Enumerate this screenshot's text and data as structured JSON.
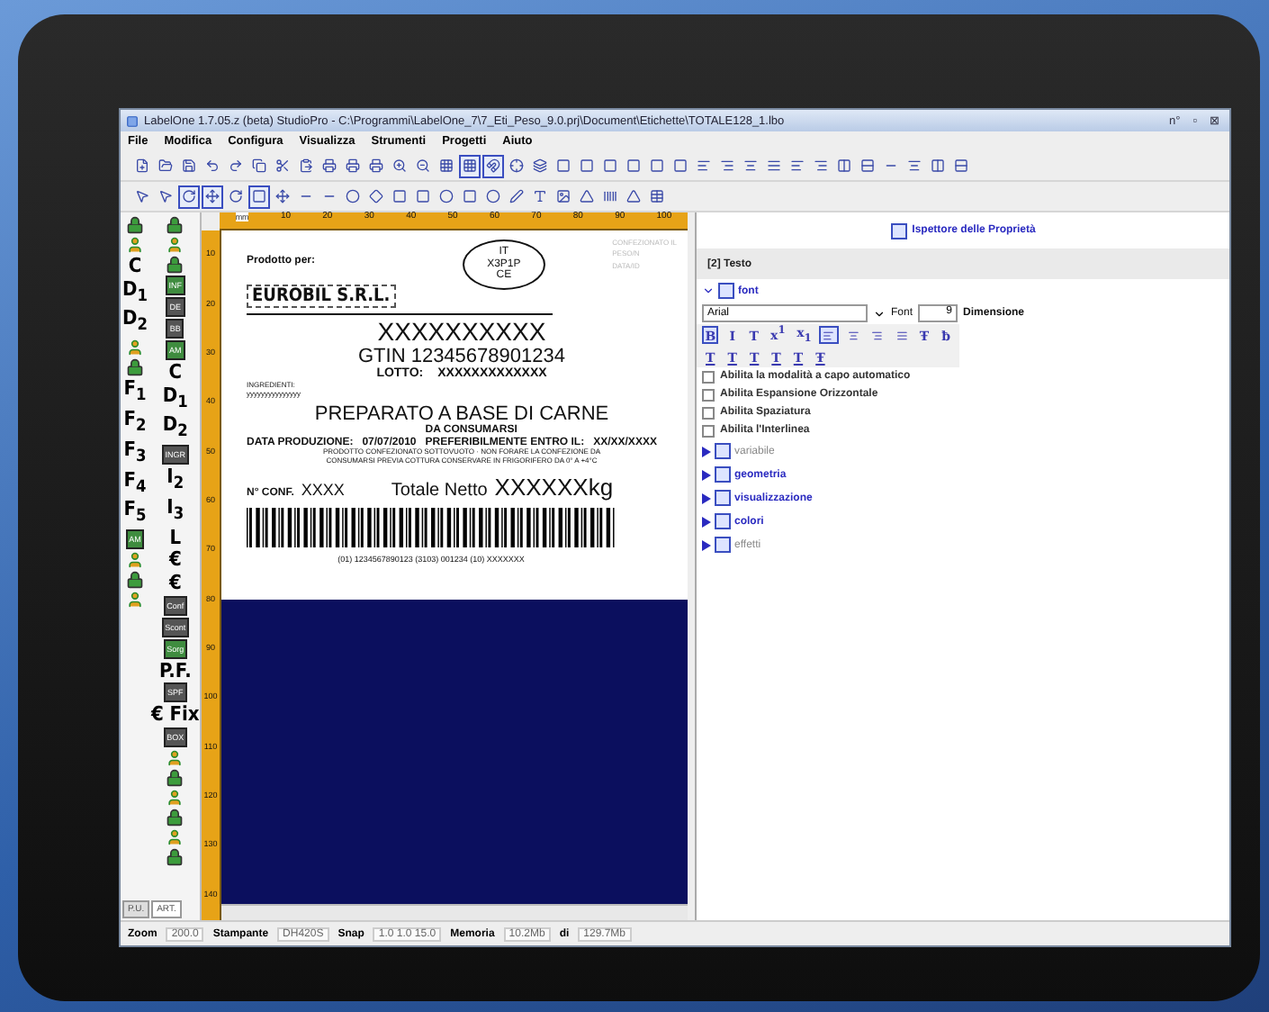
{
  "window": {
    "title": "LabelOne 1.7.05.z (beta) StudioPro - C:\\Programmi\\LabelOne_7\\7_Eti_Peso_9.0.prj\\Document\\Etichette\\TOTALE128_1.lbo",
    "controls": [
      "n°",
      "▫",
      "⊠"
    ]
  },
  "menu": [
    "File",
    "Modifica",
    "Configura",
    "Visualizza",
    "Strumenti",
    "Progetti",
    "Aiuto"
  ],
  "toolbar_1": [
    {
      "on": false
    },
    {
      "on": false
    },
    {
      "on": false
    },
    {
      "on": false
    },
    {
      "on": false
    },
    {
      "on": false
    },
    {
      "on": false
    },
    {
      "on": false
    },
    {
      "on": false
    },
    {
      "on": false
    },
    {
      "on": false
    },
    {
      "on": false
    },
    {
      "on": false
    },
    {
      "on": false
    },
    {
      "on": true
    },
    {
      "on": true
    },
    {
      "on": false
    },
    {
      "on": false
    },
    {
      "on": false
    },
    {
      "on": false
    },
    {
      "on": false
    },
    {
      "on": false
    },
    {
      "on": false
    },
    {
      "on": false
    },
    {
      "on": false
    },
    {
      "on": false
    },
    {
      "on": false
    },
    {
      "on": false
    },
    {
      "on": false
    },
    {
      "on": false
    },
    {
      "on": false
    },
    {
      "on": false
    },
    {
      "on": false
    },
    {
      "on": false
    },
    {
      "on": false
    },
    {
      "on": false
    }
  ],
  "toolbar_2": [
    {
      "on": false
    },
    {
      "on": false
    },
    {
      "on": true
    },
    {
      "on": true
    },
    {
      "on": false
    },
    {
      "on": true
    },
    {
      "on": false
    },
    {
      "on": false
    },
    {
      "on": false
    },
    {
      "on": false
    },
    {
      "on": false
    },
    {
      "on": false
    },
    {
      "on": false
    },
    {
      "on": false
    },
    {
      "on": false
    },
    {
      "on": false
    },
    {
      "on": false
    },
    {
      "on": false
    },
    {
      "on": false
    },
    {
      "on": false
    },
    {
      "on": false
    },
    {
      "on": false
    },
    {
      "on": false
    }
  ],
  "palette": {
    "column_1": [
      {
        "kind": "icon"
      },
      {
        "kind": "icon"
      },
      {
        "kind": "text",
        "label": "C"
      },
      {
        "kind": "text",
        "label": "D$_{1}$"
      },
      {
        "kind": "text",
        "label": "D$_{2}$"
      },
      {
        "kind": "icon"
      },
      {
        "kind": "icon"
      },
      {
        "kind": "text",
        "label": "F$_{1}$"
      },
      {
        "kind": "text",
        "label": "F$_{2}$"
      },
      {
        "kind": "text",
        "label": "F$_{3}$"
      },
      {
        "kind": "text",
        "label": "F$_{4}$"
      },
      {
        "kind": "text",
        "label": "F$_{5}$"
      },
      {
        "kind": "tile",
        "label": "AM"
      },
      {
        "kind": "icon"
      },
      {
        "kind": "icon"
      },
      {
        "kind": "icon"
      }
    ],
    "column_2": [
      {
        "kind": "icon"
      },
      {
        "kind": "icon"
      },
      {
        "kind": "icon"
      },
      {
        "kind": "tile",
        "label": "INF"
      },
      {
        "kind": "tile",
        "label": "DE"
      },
      {
        "kind": "tile",
        "label": "BB"
      },
      {
        "kind": "tile",
        "label": "AM"
      },
      {
        "kind": "text",
        "label": "C"
      },
      {
        "kind": "text",
        "label": "D$_{1}$"
      },
      {
        "kind": "text",
        "label": "D$_{2}$"
      },
      {
        "kind": "tile",
        "label": "INGR"
      },
      {
        "kind": "text",
        "label": "I$_{2}$"
      },
      {
        "kind": "text",
        "label": "I$_{3}$"
      },
      {
        "kind": "text",
        "label": "L"
      },
      {
        "kind": "text",
        "label": "€"
      },
      {
        "kind": "text",
        "label": "€"
      },
      {
        "kind": "tile",
        "label": "Conf"
      },
      {
        "kind": "tile",
        "label": "Scont"
      },
      {
        "kind": "tile",
        "label": "Sorg"
      },
      {
        "kind": "text",
        "label": "P.F."
      },
      {
        "kind": "tile",
        "label": "SPF"
      },
      {
        "kind": "text",
        "label": "€ Fix"
      },
      {
        "kind": "tile",
        "label": "BOX"
      },
      {
        "kind": "icon"
      },
      {
        "kind": "icon"
      },
      {
        "kind": "icon"
      },
      {
        "kind": "icon"
      },
      {
        "kind": "icon"
      },
      {
        "kind": "icon"
      }
    ],
    "tabs": [
      {
        "label": "P.U.",
        "selected": false
      },
      {
        "label": "ART.",
        "selected": true
      }
    ]
  },
  "rulers": {
    "unit": "mm",
    "horizontal": [
      "10",
      "20",
      "30",
      "40",
      "50",
      "60",
      "70",
      "80",
      "90",
      "100"
    ],
    "vertical": [
      "10",
      "20",
      "30",
      "40",
      "50",
      "60",
      "70",
      "80",
      "90",
      "100",
      "110",
      "120",
      "130",
      "140"
    ]
  },
  "label": {
    "producer_caption": "Prodotto per:",
    "producer": "EUROBIL S.R.L.",
    "stamp": [
      "IT",
      "X3P1P",
      "CE"
    ],
    "faint_fields": [
      "CONFEZIONATO IL",
      "PESO/N",
      "DATA/ID"
    ],
    "product_code": "XXXXXXXXXX",
    "gtin": "GTIN  12345678901234",
    "lot_caption": "LOTTO:",
    "lot": "XXXXXXXXXXXXX",
    "ingredients_caption": "INGREDIENTI:",
    "ingredients": "yyyyyyyyyyyyyyy",
    "product_name": "PREPARATO A BASE DI CARNE",
    "production_caption": "DATA PRODUZIONE:",
    "production_date": "07/07/2010",
    "expiry_caption_1": "DA CONSUMARSI",
    "expiry_caption_2": "PREFERIBILMENTE ENTRO IL:",
    "expiry": "XX/XX/XXXX",
    "notes": "PRODOTTO CONFEZIONATO SOTTOVUOTO · NON FORARE LA CONFEZIONE DA CONSUMARSI PREVIA COTTURA CONSERVARE IN FRIGORIFERO DA 0° A +4°C",
    "pieces_caption": "N° CONF.",
    "pieces": "XXXX",
    "net_caption": "Totale Netto",
    "net": "XXXXXXkg",
    "barcode_text": "(01) 1234567890123 (3103) 001234 (10) XXXXXXX"
  },
  "inspector": {
    "title": "Ispettore delle Proprietà",
    "tab": "[2] Testo",
    "font_section": {
      "label": "font",
      "expanded": true
    },
    "font_name": "Arial",
    "font_caption": "Font",
    "size": "9",
    "size_caption": "Dimensione",
    "format_row_1": [
      {
        "kind": "text",
        "label": "B",
        "selected": true
      },
      {
        "kind": "text",
        "label": "I",
        "selected": false
      },
      {
        "kind": "text",
        "label": "T",
        "selected": false
      },
      {
        "kind": "text",
        "label": "x$^{1}$",
        "selected": false
      },
      {
        "kind": "text",
        "label": "x$_{1}$",
        "selected": false
      },
      {
        "kind": "align",
        "selected": true
      },
      {
        "kind": "align",
        "selected": false
      },
      {
        "kind": "align",
        "selected": false
      },
      {
        "kind": "align",
        "selected": false
      },
      {
        "kind": "text",
        "label": "Ŧ",
        "selected": false
      },
      {
        "kind": "text",
        "label": "ƀ",
        "selected": false
      }
    ],
    "format_row_2": [
      "T",
      "T",
      "T",
      "T",
      "T",
      "Ŧ"
    ],
    "options": [
      {
        "label": "Abilita la modalità a capo automatico",
        "checked": false
      },
      {
        "label": "Abilita Espansione Orizzontale",
        "checked": false
      },
      {
        "label": "Abilita Spaziatura",
        "checked": false
      },
      {
        "label": "Abilita l'Interlinea",
        "checked": false
      }
    ],
    "sections": [
      {
        "label": "variabile",
        "disabled": true,
        "expanded": false
      },
      {
        "label": "geometria",
        "disabled": false,
        "expanded": false
      },
      {
        "label": "visualizzazione",
        "disabled": false,
        "expanded": false
      },
      {
        "label": "colori",
        "disabled": false,
        "expanded": false
      },
      {
        "label": "effetti",
        "disabled": true,
        "expanded": false
      }
    ]
  },
  "status_bar": [
    {
      "caption": "Zoom",
      "value": "200.0"
    },
    {
      "caption": "Stampante",
      "value": "DH420S"
    },
    {
      "caption": "Snap",
      "value": "1.0  1.0  15.0"
    },
    {
      "caption": "Memoria",
      "value": "10.2Mb"
    },
    {
      "caption": "di",
      "value": "129.7Mb"
    }
  ]
}
